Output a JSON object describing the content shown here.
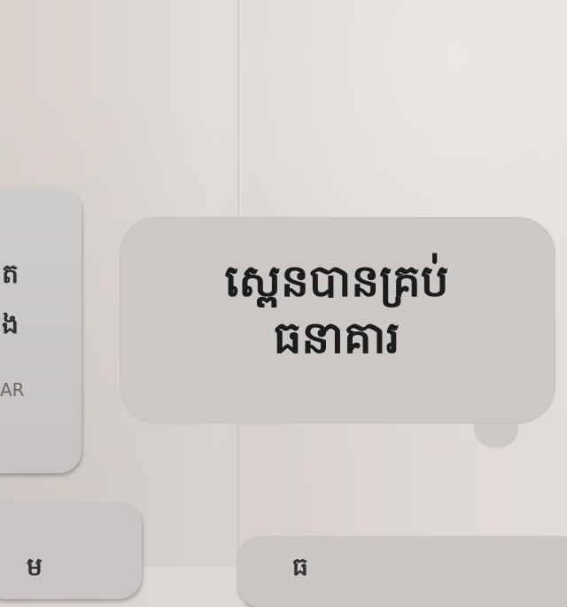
{
  "scene": {
    "wall_color": "#dfd9d5",
    "panel_color": "#c9c6c4",
    "text_color": "#1c1c1c"
  },
  "left_sign": {
    "line1": "ត",
    "line2": "ង",
    "small": "AR"
  },
  "center_sign": {
    "line1": "ស្ពេនបាន​គ្រប់",
    "line2": "ធនាគារ"
  },
  "bottom_signs": {
    "left_partial": "ម",
    "right_partial": "ធ"
  }
}
